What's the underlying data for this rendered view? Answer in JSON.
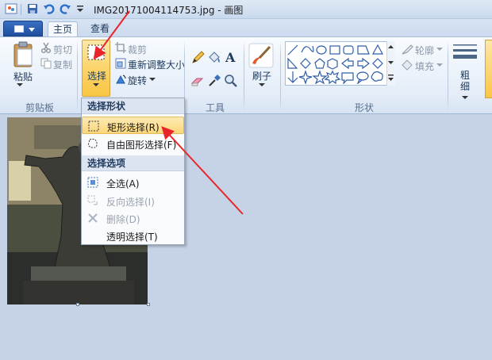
{
  "window": {
    "title": "IMG20171004114753.jpg - 画图"
  },
  "tabs": {
    "home": "主页",
    "view": "查看"
  },
  "clipboard": {
    "paste": "粘贴",
    "cut": "剪切",
    "copy": "复制",
    "group": "剪贴板"
  },
  "image": {
    "select": "选择",
    "crop": "裁剪",
    "resize": "重新调整大小",
    "rotate": "旋转"
  },
  "tools": {
    "group": "工具"
  },
  "brushes": {
    "label": "刷子"
  },
  "shapes": {
    "outline": "轮廓",
    "fill": "填充",
    "group": "形状"
  },
  "size": {
    "label": "粗\n细"
  },
  "dropdown": {
    "shape_header": "选择形状",
    "rect_select": "矩形选择(R)",
    "free_select": "自由图形选择(F)",
    "options_header": "选择选项",
    "select_all": "全选(A)",
    "invert": "反向选择(I)",
    "delete": "删除(D)",
    "transparent": "透明选择(T)"
  },
  "colors": {
    "accent": "#fbd46b",
    "arrow": "#e8262a"
  }
}
